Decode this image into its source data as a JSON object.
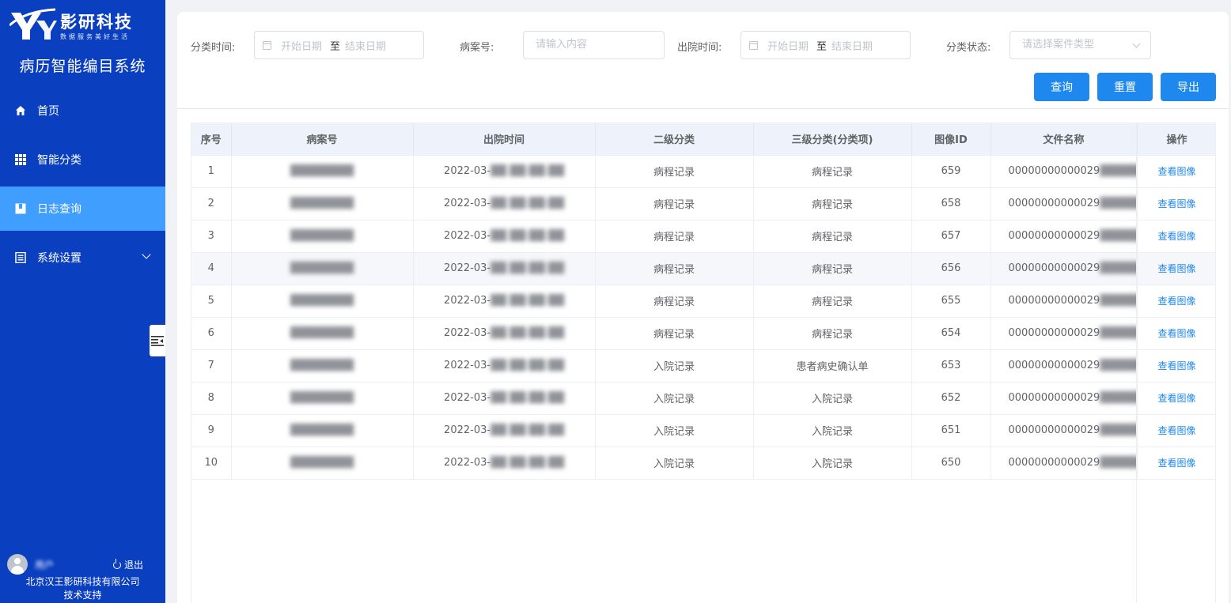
{
  "brand": {
    "name": "影研科技",
    "slogan": "数据服务美好生活",
    "system_title": "病历智能编目系统"
  },
  "sidebar": {
    "items": [
      {
        "label": "首页",
        "icon": "home-icon"
      },
      {
        "label": "智能分类",
        "icon": "grid-icon"
      },
      {
        "label": "日志查询",
        "icon": "book-icon",
        "active": true
      },
      {
        "label": "系统设置",
        "icon": "list-icon",
        "has_submenu": true
      }
    ],
    "user": {
      "name": "用户",
      "logout_label": "退出"
    },
    "company": "北京汉王影研科技有限公司",
    "support": "技术支持"
  },
  "filters": {
    "classify_time_label": "分类时间:",
    "start_placeholder": "开始日期",
    "range_separator": "至",
    "end_placeholder": "结束日期",
    "case_no_label": "病案号:",
    "case_no_placeholder": "请输入内容",
    "discharge_time_label": "出院时间:",
    "status_label": "分类状态:",
    "status_placeholder": "请选择案件类型"
  },
  "buttons": {
    "query": "查询",
    "reset": "重置",
    "export": "导出"
  },
  "table": {
    "columns": [
      "序号",
      "病案号",
      "出院时间",
      "二级分类",
      "三级分类(分类项)",
      "图像ID",
      "文件名称",
      "操作"
    ],
    "rows": [
      {
        "idx": "1",
        "case_no": "████████",
        "discharge": "2022-03-",
        "discharge_hidden": "██ ██:██:██",
        "level2": "病程记录",
        "level3": "病程记录",
        "image_id": "659",
        "filename": "00000000000029",
        "filename_hidden": "██████",
        "action": "查看图像"
      },
      {
        "idx": "2",
        "case_no": "████████",
        "discharge": "2022-03-",
        "discharge_hidden": "██ ██:██:██",
        "level2": "病程记录",
        "level3": "病程记录",
        "image_id": "658",
        "filename": "00000000000029",
        "filename_hidden": "██████",
        "action": "查看图像"
      },
      {
        "idx": "3",
        "case_no": "████████",
        "discharge": "2022-03-",
        "discharge_hidden": "██ ██:██:██",
        "level2": "病程记录",
        "level3": "病程记录",
        "image_id": "657",
        "filename": "00000000000029",
        "filename_hidden": "██████",
        "action": "查看图像"
      },
      {
        "idx": "4",
        "case_no": "████████",
        "discharge": "2022-03-",
        "discharge_hidden": "██ ██:██:██",
        "level2": "病程记录",
        "level3": "病程记录",
        "image_id": "656",
        "filename": "00000000000029",
        "filename_hidden": "██████",
        "action": "查看图像"
      },
      {
        "idx": "5",
        "case_no": "████████",
        "discharge": "2022-03-",
        "discharge_hidden": "██ ██:██:██",
        "level2": "病程记录",
        "level3": "病程记录",
        "image_id": "655",
        "filename": "00000000000029",
        "filename_hidden": "██████",
        "action": "查看图像"
      },
      {
        "idx": "6",
        "case_no": "████████",
        "discharge": "2022-03-",
        "discharge_hidden": "██ ██:██:██",
        "level2": "病程记录",
        "level3": "病程记录",
        "image_id": "654",
        "filename": "00000000000029",
        "filename_hidden": "██████",
        "action": "查看图像"
      },
      {
        "idx": "7",
        "case_no": "████████",
        "discharge": "2022-03-",
        "discharge_hidden": "██ ██:██:██",
        "level2": "入院记录",
        "level3": "患者病史确认单",
        "image_id": "653",
        "filename": "00000000000029",
        "filename_hidden": "██████",
        "action": "查看图像"
      },
      {
        "idx": "8",
        "case_no": "████████",
        "discharge": "2022-03-",
        "discharge_hidden": "██ ██:██:██",
        "level2": "入院记录",
        "level3": "入院记录",
        "image_id": "652",
        "filename": "00000000000029",
        "filename_hidden": "██████",
        "action": "查看图像"
      },
      {
        "idx": "9",
        "case_no": "████████",
        "discharge": "2022-03-",
        "discharge_hidden": "██ ██:██:██",
        "level2": "入院记录",
        "level3": "入院记录",
        "image_id": "651",
        "filename": "00000000000029",
        "filename_hidden": "██████",
        "action": "查看图像"
      },
      {
        "idx": "10",
        "case_no": "████████",
        "discharge": "2022-03-",
        "discharge_hidden": "██ ██:██:██",
        "level2": "入院记录",
        "level3": "入院记录",
        "image_id": "650",
        "filename": "00000000000029",
        "filename_hidden": "██████",
        "action": "查看图像"
      }
    ]
  },
  "colors": {
    "sidebar_bg": "#0a3fc0",
    "active_item": "#409eff",
    "primary_button": "#1e88ef",
    "link": "#1e88ef"
  }
}
